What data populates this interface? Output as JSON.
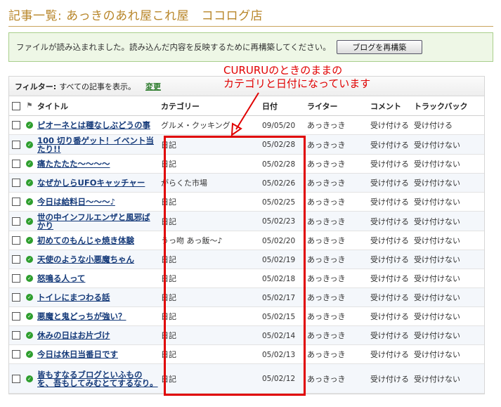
{
  "page": {
    "title": "記事一覧: あっきのあれ屋これ屋　ココログ店"
  },
  "notice": {
    "message": "ファイルが読み込まれました。読み込んだ内容を反映するために再構築してください。",
    "rebuild_label": "ブログを再構築"
  },
  "filter": {
    "label": "フィルター:",
    "value": "すべての記事を表示。",
    "change_label": "変更"
  },
  "table": {
    "headers": {
      "title": "タイトル",
      "category": "カテゴリー",
      "date": "日付",
      "writer": "ライター",
      "comment": "コメント",
      "trackback": "トラックバック"
    },
    "rows": [
      {
        "title": "ピオーネとは種なしぶどうの事",
        "category": "グルメ・クッキング",
        "date": "09/05/20",
        "writer": "あっきっき",
        "comment": "受け付ける",
        "trackback": "受け付ける"
      },
      {
        "title": "100 切り番ゲット！イベント当たり!!",
        "category": "日記",
        "date": "05/02/28",
        "writer": "あっきっき",
        "comment": "受け付ける",
        "trackback": "受け付けない"
      },
      {
        "title": "痛たたたた～～～～",
        "category": "日記",
        "date": "05/02/28",
        "writer": "あっきっき",
        "comment": "受け付ける",
        "trackback": "受け付けない"
      },
      {
        "title": "なぜかしらUFOキャッチャー",
        "category": "がらくた市場",
        "date": "05/02/26",
        "writer": "あっきっき",
        "comment": "受け付ける",
        "trackback": "受け付けない"
      },
      {
        "title": "今日は給料日～～～♪",
        "category": "日記",
        "date": "05/02/25",
        "writer": "あっきっき",
        "comment": "受け付ける",
        "trackback": "受け付けない"
      },
      {
        "title": "世の中インフルエンザと風邪ばかり",
        "category": "日記",
        "date": "05/02/23",
        "writer": "あっきっき",
        "comment": "受け付ける",
        "trackback": "受け付けない"
      },
      {
        "title": "初めてのもんじゃ焼き体験",
        "category": "うっ吻 あっ飯～♪",
        "date": "05/02/20",
        "writer": "あっきっき",
        "comment": "受け付ける",
        "trackback": "受け付けない"
      },
      {
        "title": "天使のような小悪魔ちゃん",
        "category": "日記",
        "date": "05/02/19",
        "writer": "あっきっき",
        "comment": "受け付ける",
        "trackback": "受け付けない"
      },
      {
        "title": "怒鳴る人って",
        "category": "日記",
        "date": "05/02/18",
        "writer": "あっきっき",
        "comment": "受け付ける",
        "trackback": "受け付けない"
      },
      {
        "title": "トイレにまつわる話",
        "category": "日記",
        "date": "05/02/17",
        "writer": "あっきっき",
        "comment": "受け付ける",
        "trackback": "受け付けない"
      },
      {
        "title": "悪魔と鬼どっちが強い？",
        "category": "日記",
        "date": "05/02/15",
        "writer": "あっきっき",
        "comment": "受け付ける",
        "trackback": "受け付けない"
      },
      {
        "title": "休みの日はお片づけ",
        "category": "日記",
        "date": "05/02/14",
        "writer": "あっきっき",
        "comment": "受け付ける",
        "trackback": "受け付けない"
      },
      {
        "title": "今日は休日当番日です",
        "category": "日記",
        "date": "05/02/13",
        "writer": "あっきっき",
        "comment": "受け付ける",
        "trackback": "受け付けない"
      },
      {
        "title": "皆もすなるブログといふものを、吾もしてみむとてするなり。",
        "category": "日記",
        "date": "05/02/12",
        "writer": "あっきっき",
        "comment": "受け付ける",
        "trackback": "受け付けない"
      }
    ]
  },
  "annotation": {
    "line1": "CURURUのときのままの",
    "line2": "カテゴリと日付になっています",
    "color": "#e00000"
  },
  "icons": {
    "status": "check-circle-icon",
    "flag": "flag-icon"
  }
}
